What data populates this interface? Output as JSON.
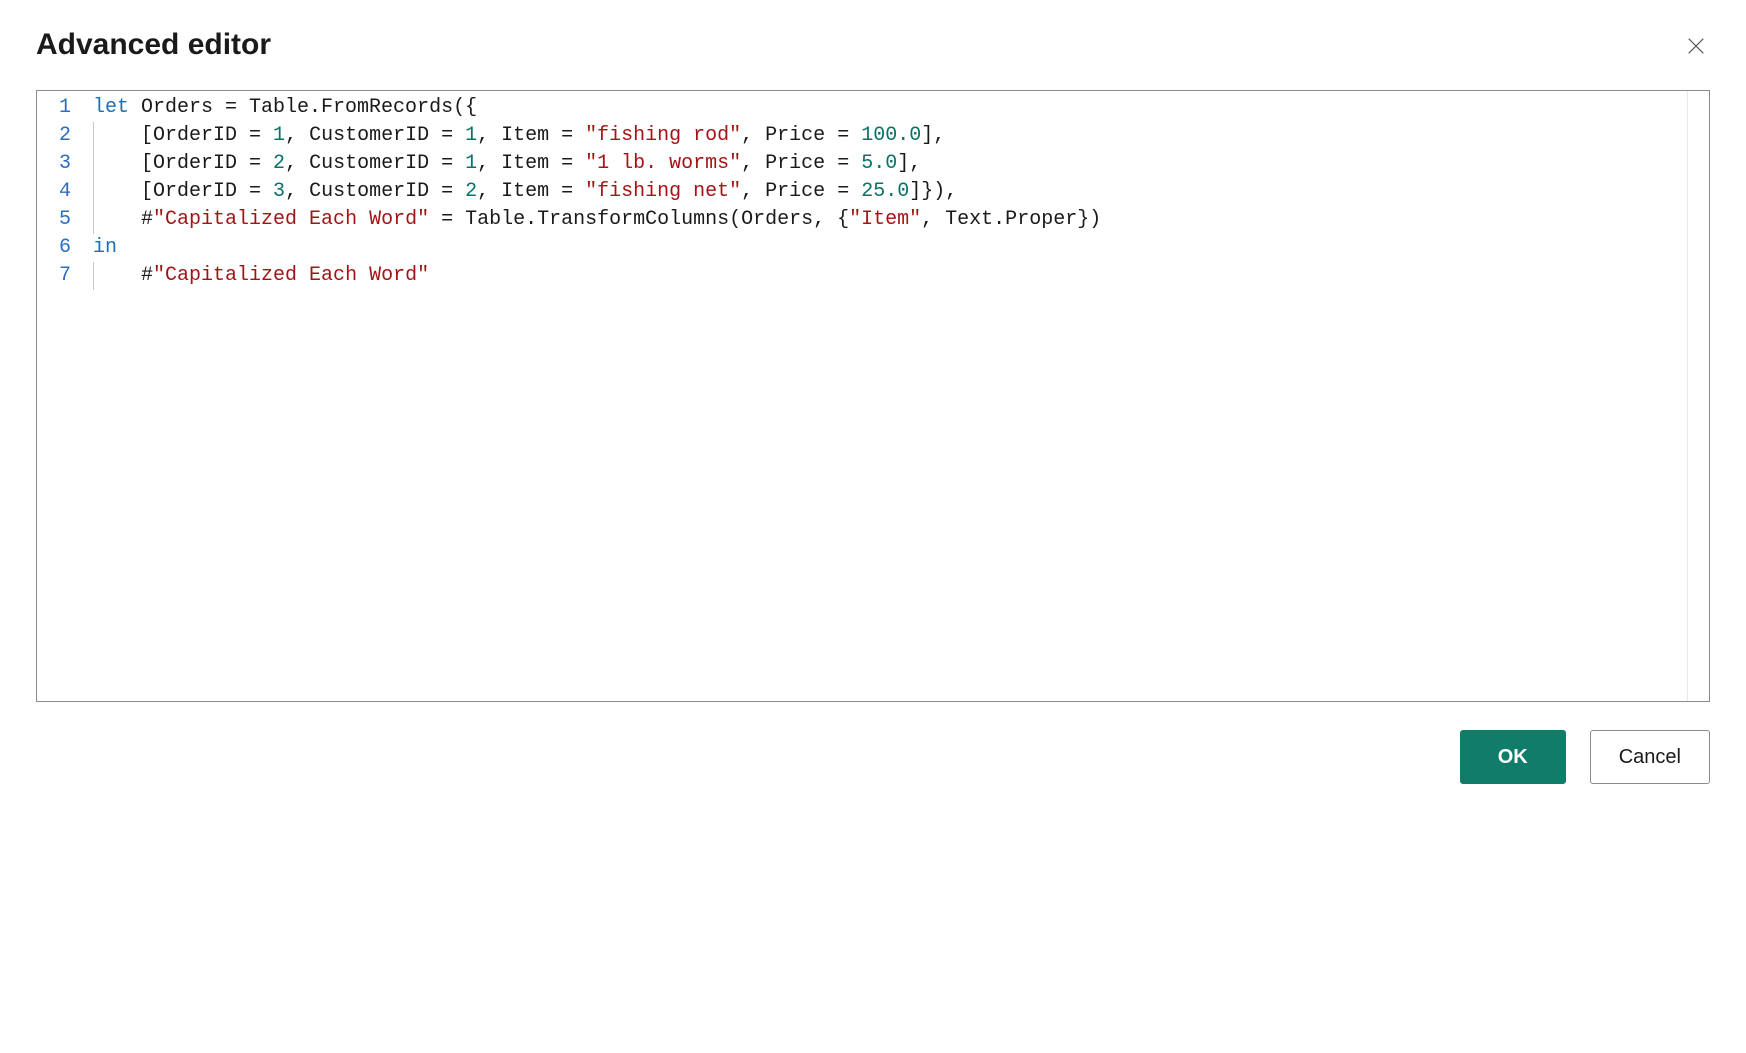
{
  "dialog": {
    "title": "Advanced editor",
    "ok_label": "OK",
    "cancel_label": "Cancel"
  },
  "editor": {
    "line_count": 7,
    "lines": [
      {
        "indent": 0,
        "tokens": [
          {
            "t": "kw",
            "v": "let"
          },
          {
            "t": "pl",
            "v": " Orders = Table.FromRecords({"
          }
        ]
      },
      {
        "indent": 1,
        "tokens": [
          {
            "t": "pl",
            "v": "[OrderID = "
          },
          {
            "t": "num",
            "v": "1"
          },
          {
            "t": "pl",
            "v": ", CustomerID = "
          },
          {
            "t": "num",
            "v": "1"
          },
          {
            "t": "pl",
            "v": ", Item = "
          },
          {
            "t": "str",
            "v": "\"fishing rod\""
          },
          {
            "t": "pl",
            "v": ", Price = "
          },
          {
            "t": "num",
            "v": "100.0"
          },
          {
            "t": "pl",
            "v": "],"
          }
        ]
      },
      {
        "indent": 1,
        "tokens": [
          {
            "t": "pl",
            "v": "[OrderID = "
          },
          {
            "t": "num",
            "v": "2"
          },
          {
            "t": "pl",
            "v": ", CustomerID = "
          },
          {
            "t": "num",
            "v": "1"
          },
          {
            "t": "pl",
            "v": ", Item = "
          },
          {
            "t": "str",
            "v": "\"1 lb. worms\""
          },
          {
            "t": "pl",
            "v": ", Price = "
          },
          {
            "t": "num",
            "v": "5.0"
          },
          {
            "t": "pl",
            "v": "],"
          }
        ]
      },
      {
        "indent": 1,
        "tokens": [
          {
            "t": "pl",
            "v": "[OrderID = "
          },
          {
            "t": "num",
            "v": "3"
          },
          {
            "t": "pl",
            "v": ", CustomerID = "
          },
          {
            "t": "num",
            "v": "2"
          },
          {
            "t": "pl",
            "v": ", Item = "
          },
          {
            "t": "str",
            "v": "\"fishing net\""
          },
          {
            "t": "pl",
            "v": ", Price = "
          },
          {
            "t": "num",
            "v": "25.0"
          },
          {
            "t": "pl",
            "v": "]}),"
          }
        ]
      },
      {
        "indent": 1,
        "tokens": [
          {
            "t": "pl",
            "v": "#"
          },
          {
            "t": "str",
            "v": "\"Capitalized Each Word\""
          },
          {
            "t": "pl",
            "v": " = Table.TransformColumns(Orders, {"
          },
          {
            "t": "str",
            "v": "\"Item\""
          },
          {
            "t": "pl",
            "v": ", Text.Proper})"
          }
        ]
      },
      {
        "indent": 0,
        "tokens": [
          {
            "t": "kw",
            "v": "in"
          }
        ]
      },
      {
        "indent": 1,
        "tokens": [
          {
            "t": "pl",
            "v": "#"
          },
          {
            "t": "str",
            "v": "\"Capitalized Each Word\""
          }
        ]
      }
    ]
  }
}
